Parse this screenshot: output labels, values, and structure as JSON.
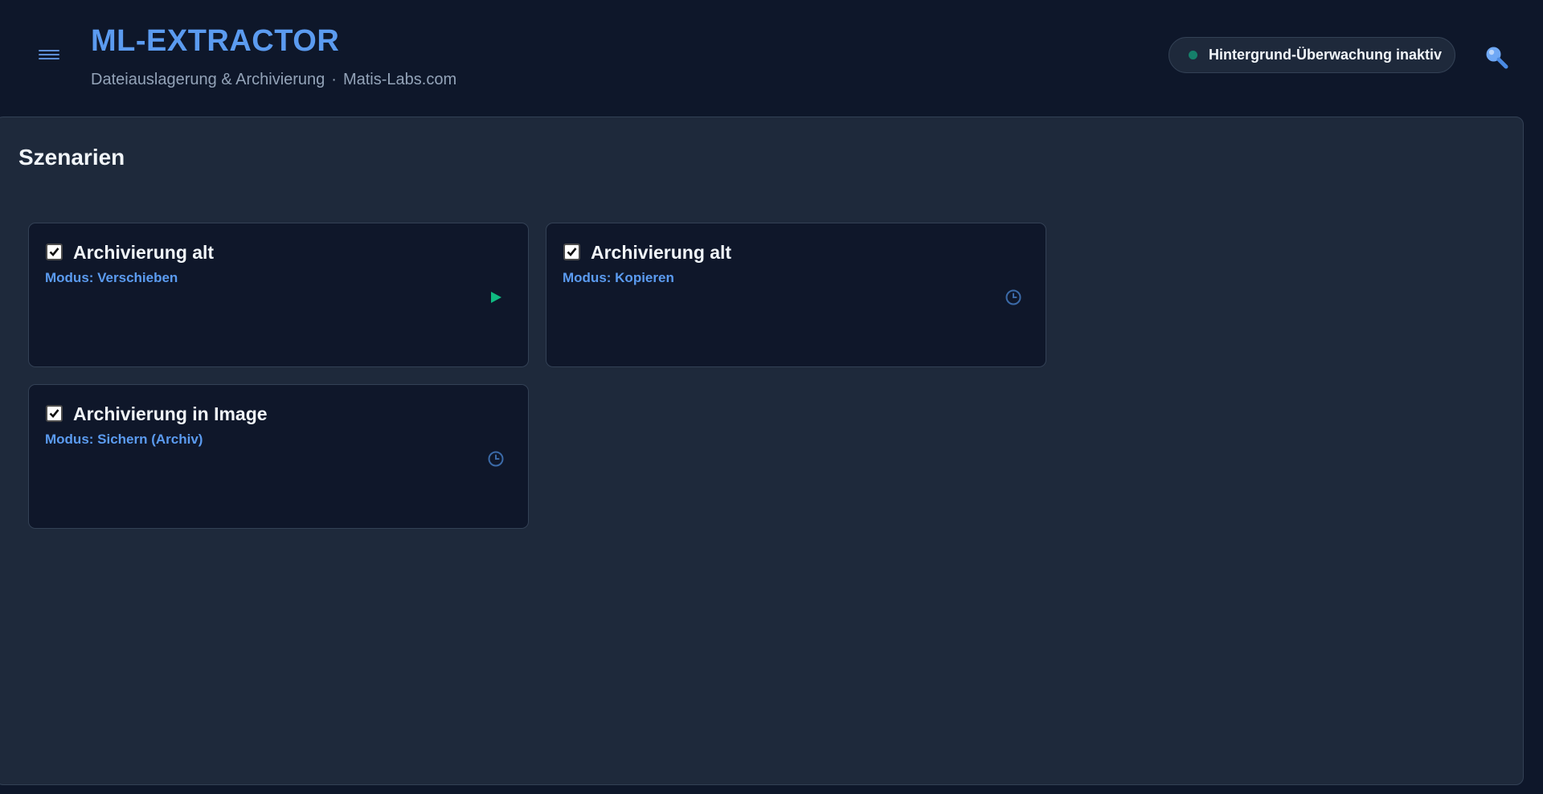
{
  "header": {
    "title": "ML-EXTRACTOR",
    "subtitle_part1": "Dateiauslagerung & Archivierung",
    "subtitle_separator": "·",
    "subtitle_part2": "Matis-Labs.com",
    "status_text": "Hintergrund-Überwachung inaktiv",
    "status_color": "#15806a",
    "menu_icon": "hamburger-menu-icon",
    "search_icon": "search-icon"
  },
  "main": {
    "section_title": "Szenarien",
    "scenarios": [
      {
        "title": "Archivierung alt",
        "mode": "Modus: Verschieben",
        "checked": true,
        "action_icon": "play-icon"
      },
      {
        "title": "Archivierung alt",
        "mode": "Modus: Kopieren",
        "checked": true,
        "action_icon": "clock-icon"
      },
      {
        "title": "Archivierung in Image",
        "mode": "Modus: Sichern (Archiv)",
        "checked": true,
        "action_icon": "clock-icon"
      }
    ]
  },
  "colors": {
    "accent": "#5b9bf0",
    "background": "#0e172a",
    "panel": "#1e293b",
    "card": "#0f172a",
    "play": "#10b981",
    "clock": "#3b6aa8"
  }
}
